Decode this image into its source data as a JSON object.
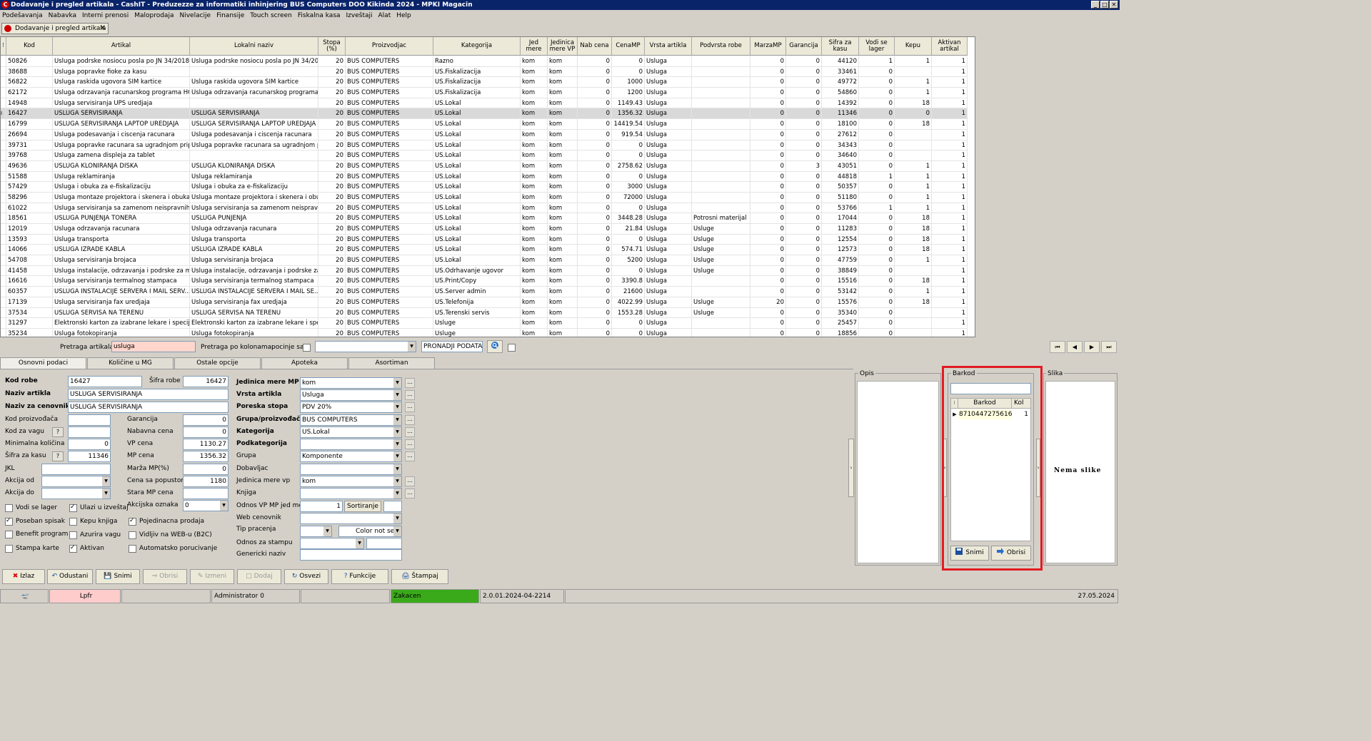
{
  "window": {
    "title": "Dodavanje i pregled artikala - CashIT - Preduzezze za informatiki inhinjering BUS Computers DOO Kikinda 2024 - MPKI Magacin"
  },
  "menu": [
    "Podešavanja",
    "Nabavka",
    "Interni prenosi",
    "Maloprodaja",
    "Nivelacije",
    "Finansije",
    "Touch screen",
    "Fiskalna kasa",
    "Izveštaji",
    "Alat",
    "Help"
  ],
  "doc_tab": "Dodavanje i pregled artikala",
  "grid": {
    "columns": [
      "Kod",
      "Artikal",
      "Lokalni naziv",
      "Stopa (%)",
      "Proizvodjac",
      "Kategorija",
      "Jed mere",
      "Jedinica mere VP",
      "Nab cena",
      "CenaMP",
      "Vrsta artikla",
      "Podvrsta robe",
      "MarzaMP",
      "Garancija",
      "Sifra za kasu",
      "Vodi se lager",
      "Kepu",
      "Aktivan artikal"
    ],
    "rows": [
      [
        "50826",
        "Usluga podrske nosiocu posla po JN 34/2018 ...",
        "Usluga podrske nosiocu posla po JN 34/20...",
        "20",
        "BUS COMPUTERS",
        "Razno",
        "kom",
        "kom",
        "0",
        "0",
        "Usluga",
        "",
        "0",
        "0",
        "44120",
        "1",
        "1",
        "1"
      ],
      [
        "38688",
        "Usluga popravke fioke za kasu",
        "",
        "20",
        "BUS COMPUTERS",
        "US.Fiskalizacija",
        "kom",
        "kom",
        "0",
        "0",
        "Usluga",
        "",
        "0",
        "0",
        "33461",
        "0",
        "",
        "1"
      ],
      [
        "56822",
        "Usluga raskida ugovora SIM kartice",
        "Usluga raskida ugovora SIM kartice",
        "20",
        "BUS COMPUTERS",
        "US.Fiskalizacija",
        "kom",
        "kom",
        "0",
        "1000",
        "Usluga",
        "",
        "0",
        "0",
        "49772",
        "0",
        "1",
        "1"
      ],
      [
        "62172",
        "Usluga odrzavanja racunarskog programa HC...",
        "Usluga odrzavanja racunarskog programa ...",
        "20",
        "BUS COMPUTERS",
        "US.Fiskalizacija",
        "kom",
        "kom",
        "0",
        "1200",
        "Usluga",
        "",
        "0",
        "0",
        "54860",
        "0",
        "1",
        "1"
      ],
      [
        "14948",
        "Usluga servisiranja UPS uredjaja",
        "",
        "20",
        "BUS COMPUTERS",
        "US.Lokal",
        "kom",
        "kom",
        "0",
        "1149.43",
        "Usluga",
        "",
        "0",
        "0",
        "14392",
        "0",
        "18",
        "1"
      ],
      [
        "16427",
        "USLUGA SERVISIRANJA",
        "USLUGA SERVISIRANJA",
        "20",
        "BUS COMPUTERS",
        "US.Lokal",
        "kom",
        "kom",
        "0",
        "1356.32",
        "Usluga",
        "",
        "0",
        "0",
        "11346",
        "0",
        "0",
        "1"
      ],
      [
        "16799",
        "USLUGA SERVISIRANJA LAPTOP UREDJAJA",
        "USLUGA SERVISIRANJA LAPTOP UREDJAJA",
        "20",
        "BUS COMPUTERS",
        "US.Lokal",
        "kom",
        "kom",
        "0",
        "14419.54",
        "Usluga",
        "",
        "0",
        "0",
        "18100",
        "0",
        "18",
        "1"
      ],
      [
        "26694",
        "Usluga podesavanja i ciscenja racunara",
        "Usluga podesavanja i ciscenja racunara",
        "20",
        "BUS COMPUTERS",
        "US.Lokal",
        "kom",
        "kom",
        "0",
        "919.54",
        "Usluga",
        "",
        "0",
        "0",
        "27612",
        "0",
        "",
        "1"
      ],
      [
        "39731",
        "Usluga popravke racunara sa ugradnjom prip...",
        "Usluga popravke racunara sa ugradnjom p...",
        "20",
        "BUS COMPUTERS",
        "US.Lokal",
        "kom",
        "kom",
        "0",
        "0",
        "Usluga",
        "",
        "0",
        "0",
        "34343",
        "0",
        "",
        "1"
      ],
      [
        "39768",
        "Usluga zamena displeja za tablet",
        "",
        "20",
        "BUS COMPUTERS",
        "US.Lokal",
        "kom",
        "kom",
        "0",
        "0",
        "Usluga",
        "",
        "0",
        "0",
        "34640",
        "0",
        "",
        "1"
      ],
      [
        "49636",
        "USLUGA KLONIRANJA DISKA",
        "USLUGA KLONIRANJA DISKA",
        "20",
        "BUS COMPUTERS",
        "US.Lokal",
        "kom",
        "kom",
        "0",
        "2758.62",
        "Usluga",
        "",
        "0",
        "3",
        "43051",
        "0",
        "1",
        "1"
      ],
      [
        "51588",
        "Usluga reklamiranja",
        "Usluga reklamiranja",
        "20",
        "BUS COMPUTERS",
        "US.Lokal",
        "kom",
        "kom",
        "0",
        "0",
        "Usluga",
        "",
        "0",
        "0",
        "44818",
        "1",
        "1",
        "1"
      ],
      [
        "57429",
        "Usluga i obuka za e-fiskalizaciju",
        "Usluga i obuka za e-fiskalizaciju",
        "20",
        "BUS COMPUTERS",
        "US.Lokal",
        "kom",
        "kom",
        "0",
        "3000",
        "Usluga",
        "",
        "0",
        "0",
        "50357",
        "0",
        "1",
        "1"
      ],
      [
        "58296",
        "Usluga montaze projektora i skenera i obuka",
        "Usluga montaze projektora i skenera i obuka",
        "20",
        "BUS COMPUTERS",
        "US.Lokal",
        "kom",
        "kom",
        "0",
        "72000",
        "Usluga",
        "",
        "0",
        "0",
        "51180",
        "0",
        "1",
        "1"
      ],
      [
        "61022",
        "Usluga servisiranja sa zamenom neispravnih ...",
        "Usluga servisiranja sa zamenom neispravn...",
        "20",
        "BUS COMPUTERS",
        "US.Lokal",
        "kom",
        "kom",
        "0",
        "0",
        "Usluga",
        "",
        "0",
        "0",
        "53766",
        "1",
        "1",
        "1"
      ],
      [
        "18561",
        "USLUGA PUNJENJA TONERA",
        "USLUGA PUNJENJA",
        "20",
        "BUS COMPUTERS",
        "US.Lokal",
        "kom",
        "kom",
        "0",
        "3448.28",
        "Usluga",
        "Potrosni materijal",
        "0",
        "0",
        "17044",
        "0",
        "18",
        "1"
      ],
      [
        "12019",
        "Usluga odrzavanja racunara",
        "Usluga odrzavanja racunara",
        "20",
        "BUS COMPUTERS",
        "US.Lokal",
        "kom",
        "kom",
        "0",
        "21.84",
        "Usluga",
        "Usluge",
        "0",
        "0",
        "11283",
        "0",
        "18",
        "1"
      ],
      [
        "13593",
        "Usluga transporta",
        "Usluga transporta",
        "20",
        "BUS COMPUTERS",
        "US.Lokal",
        "kom",
        "kom",
        "0",
        "0",
        "Usluga",
        "Usluge",
        "0",
        "0",
        "12554",
        "0",
        "18",
        "1"
      ],
      [
        "14066",
        "USLUGA IZRADE KABLA",
        "USLUGA IZRADE KABLA",
        "20",
        "BUS COMPUTERS",
        "US.Lokal",
        "kom",
        "kom",
        "0",
        "574.71",
        "Usluga",
        "Usluge",
        "0",
        "0",
        "12573",
        "0",
        "18",
        "1"
      ],
      [
        "54708",
        "Usluga servisiranja brojaca",
        "Usluga servisiranja brojaca",
        "20",
        "BUS COMPUTERS",
        "US.Lokal",
        "kom",
        "kom",
        "0",
        "5200",
        "Usluga",
        "Usluge",
        "0",
        "0",
        "47759",
        "0",
        "1",
        "1"
      ],
      [
        "41458",
        "Usluga instalacije, odrzavanja i podrske za m...",
        "Usluga instalacije, odrzavanja i podrske za...",
        "20",
        "BUS COMPUTERS",
        "US.Odrhavanje ugovor",
        "kom",
        "kom",
        "0",
        "0",
        "Usluga",
        "Usluge",
        "0",
        "0",
        "38849",
        "0",
        "",
        "1"
      ],
      [
        "16616",
        "Usluga servisiranja termalnog stampaca",
        "Usluga servisiranja termalnog stampaca",
        "20",
        "BUS COMPUTERS",
        "US.Print/Copy",
        "kom",
        "kom",
        "0",
        "3390.8",
        "Usluga",
        "",
        "0",
        "0",
        "15516",
        "0",
        "18",
        "1"
      ],
      [
        "60357",
        "USLUGA INSTALACIJE SERVERA I MAIL SERV...",
        "USLUGA INSTALACIJE SERVERA I MAIL SE...",
        "20",
        "BUS COMPUTERS",
        "US.Server admin",
        "kom",
        "kom",
        "0",
        "21600",
        "Usluga",
        "",
        "0",
        "0",
        "53142",
        "0",
        "1",
        "1"
      ],
      [
        "17139",
        "Usluga servisiranja fax uredjaja",
        "Usluga servisiranja fax uredjaja",
        "20",
        "BUS COMPUTERS",
        "US.Telefonija",
        "kom",
        "kom",
        "0",
        "4022.99",
        "Usluga",
        "Usluge",
        "20",
        "0",
        "15576",
        "0",
        "18",
        "1"
      ],
      [
        "37534",
        "USLUGA SERVISA NA TERENU",
        "USLUGA SERVISA NA TERENU",
        "20",
        "BUS COMPUTERS",
        "US.Terenski servis",
        "kom",
        "kom",
        "0",
        "1553.28",
        "Usluga",
        "Usluge",
        "0",
        "0",
        "35340",
        "0",
        "",
        "1"
      ],
      [
        "31297",
        "Elektronski karton za izabrane lekare i specija...",
        "Elektronski karton za izabrane lekare i spe...",
        "20",
        "BUS COMPUTERS",
        "Usluge",
        "kom",
        "kom",
        "0",
        "0",
        "Usluga",
        "",
        "0",
        "0",
        "25457",
        "0",
        "",
        "1"
      ],
      [
        "35234",
        "Usluga fotokopiranja",
        "Usluga fotokopiranja",
        "20",
        "BUS COMPUTERS",
        "Usluge",
        "kom",
        "kom",
        "0",
        "0",
        "Usluga",
        "",
        "0",
        "0",
        "18856",
        "0",
        "",
        "1"
      ]
    ]
  },
  "search": {
    "label": "Pretraga artikala",
    "value": "usluga",
    "columns_label": "Pretraga po kolonama:",
    "starts_label": "pocinje sa",
    "find_label": "PRONADJI PODATAK"
  },
  "tabs": [
    "Osnovni podaci",
    "Količine u MG",
    "Ostale opcije",
    "Apoteka",
    "Asortiman"
  ],
  "form": {
    "kod_robe_label": "Kod robe",
    "kod_robe": "16427",
    "sifra_robe_label": "Šifra robe",
    "sifra_robe": "16427",
    "naziv_label": "Naziv artikla",
    "naziv": "USLUGA SERVISIRANJA",
    "naziv_cenovnik_label": "Naziv za cenovnik",
    "naziv_cenovnik": "USLUGA SERVISIRANJA",
    "kod_proizvodjaca_label": "Kod proizvođača",
    "kod_vagu_label": "Kod za vagu",
    "min_kol_label": "Minimalna količina",
    "min_kol": "0",
    "sifra_kasu_label": "Šifra za kasu",
    "sifra_kasu": "11346",
    "jkl_label": "JKL",
    "akcija_od_label": "Akcija od",
    "akcija_do_label": "Akcija do",
    "garancija_label": "Garancija",
    "garancija": "0",
    "nabavna_label": "Nabavna cena",
    "nabavna": "0",
    "vp_label": "VP cena",
    "vp": "1130.27",
    "mp_label": "MP cena",
    "mp": "1356.32",
    "marza_label": "Marža MP(%)",
    "marza": "0",
    "popust_label": "Cena sa popustom",
    "popust": "1180",
    "stara_label": "Stara MP cena",
    "akcijska_label": "Akcijska oznaka",
    "akcijska": "0",
    "jed_mere_label": "Jedinica mere MP",
    "jed_mere": "kom",
    "vrsta_label": "Vrsta artikla",
    "vrsta": "Usluga",
    "poreska_label": "Poreska stopa",
    "poreska": "PDV 20%",
    "grupa_proiz_label": "Grupa/proizvođač",
    "grupa_proiz": "BUS COMPUTERS",
    "kategorija_label": "Kategorija",
    "kategorija": "US.Lokal",
    "podkategorija_label": "Podkategorija",
    "grupa_label": "Grupa",
    "grupa": "Komponente",
    "dobavljac_label": "Dobavljac",
    "jm_vp_label": "Jedinica mere vp",
    "jm_vp": "kom",
    "knjiga_label": "Knjiga",
    "odnos_label": "Odnos VP MP jed mere",
    "odnos": "1",
    "sortiranje": "Sortiranje",
    "web_label": "Web cenovnik",
    "tip_label": "Tip pracenja",
    "color": "Color not sel",
    "odnos_stampu_label": "Odnos za stampu",
    "generic_label": "Genericki naziv"
  },
  "checks": [
    {
      "label": "Vodi se lager",
      "on": false
    },
    {
      "label": "Ulazi u izveštaj",
      "on": true
    },
    {
      "label": "Poseban spisak",
      "on": true
    },
    {
      "label": "Kepu knjiga",
      "on": false
    },
    {
      "label": "Pojedinacna prodaja",
      "on": true
    },
    {
      "label": "Benefit program",
      "on": false
    },
    {
      "label": "Azurira vagu",
      "on": false
    },
    {
      "label": "Vidljiv na WEB-u (B2C)",
      "on": false
    },
    {
      "label": "Stampa karte",
      "on": false
    },
    {
      "label": "Aktivan",
      "on": true
    },
    {
      "label": "Automatsko porucivanje",
      "on": false
    }
  ],
  "opis": {
    "title": "Opis"
  },
  "barkod": {
    "title": "Barkod",
    "col1": "Barkod",
    "col2": "Kol",
    "code": "8710447275616",
    "kol": "1",
    "save": "Snimi",
    "delete": "Obrisi"
  },
  "slika": {
    "title": "Slika",
    "empty": "Nema slike"
  },
  "toolbar": [
    "Izlaz",
    "Odustani",
    "Snimi",
    "Obrisi",
    "Izmeni",
    "Dodaj",
    "Osvezi",
    "Funkcije",
    "Štampaj"
  ],
  "status": {
    "lpfr": "Lpfr",
    "user": "Administrator 0",
    "state": "Zakacen",
    "version": "2.0.01.2024-04-2214",
    "date": "27.05.2024"
  },
  "colors": {
    "accent": "#0a246a",
    "status_green": "#3aaa1a",
    "highlight": "#e31b23",
    "search_bg": "#ffd6cc"
  }
}
